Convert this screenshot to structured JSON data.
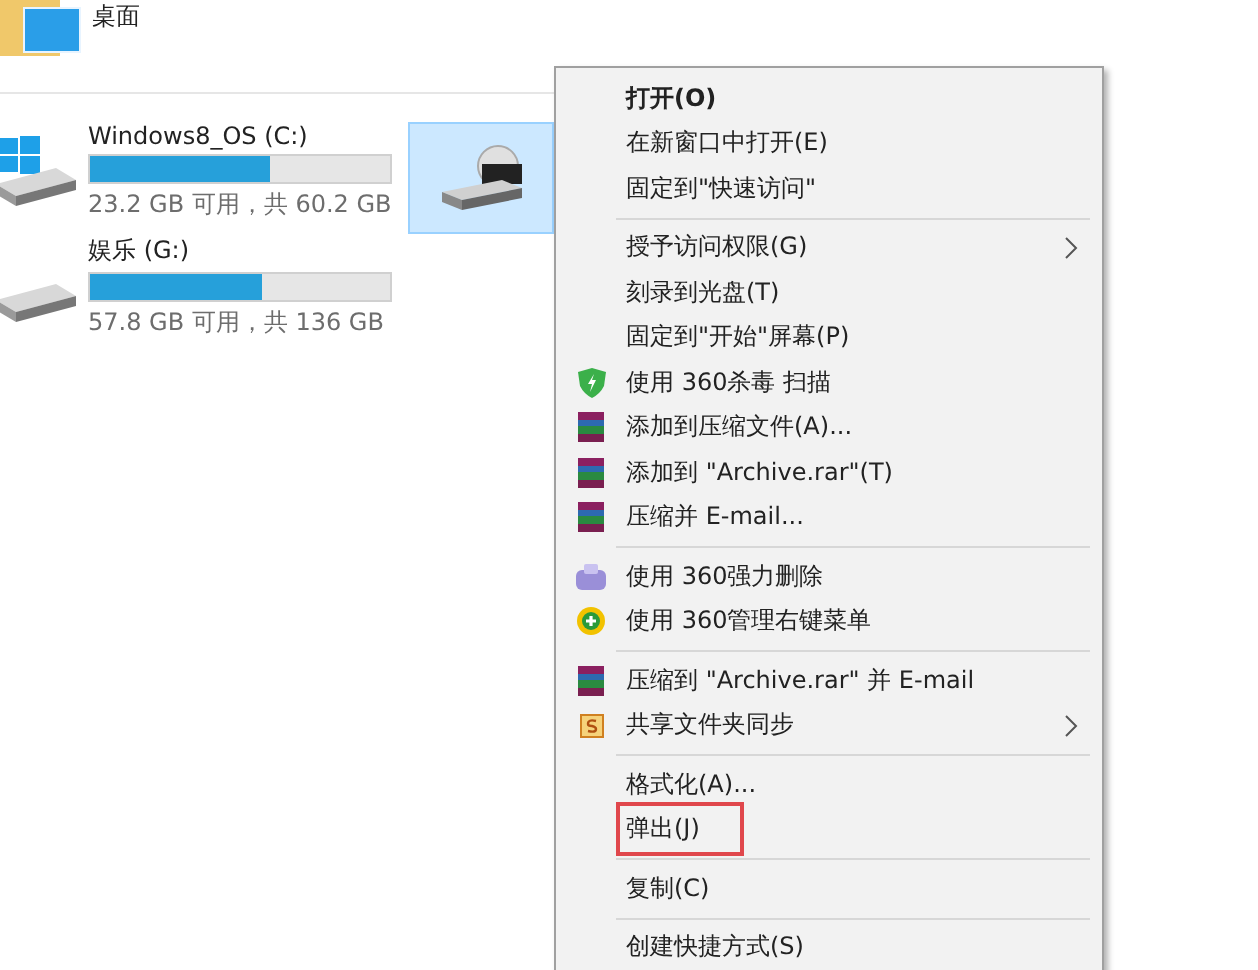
{
  "folder": {
    "label": "桌面"
  },
  "drives": [
    {
      "kind": "windows",
      "name": "Windows8_OS (C:)",
      "level": 0.6,
      "space": "23.2 GB 可用，共 60.2 GB"
    },
    {
      "kind": "disk",
      "name": "娱乐 (G:)",
      "level": 0.57,
      "space": "57.8 GB 可用，共 136 GB"
    }
  ],
  "dvd_tile": {
    "selected": true
  },
  "context_menu": {
    "groups": [
      [
        {
          "label": "打开(O)",
          "kind": "plain",
          "default": true,
          "submenu": false,
          "marked": false
        },
        {
          "label": "在新窗口中打开(E)",
          "kind": "plain",
          "default": false,
          "submenu": false,
          "marked": false
        },
        {
          "label": "固定到\"快速访问\"",
          "kind": "plain",
          "default": false,
          "submenu": false,
          "marked": false
        }
      ],
      [
        {
          "label": "授予访问权限(G)",
          "kind": "plain",
          "default": false,
          "submenu": true,
          "marked": false
        },
        {
          "label": "刻录到光盘(T)",
          "kind": "plain",
          "default": false,
          "submenu": false,
          "marked": false
        },
        {
          "label": "固定到\"开始\"屏幕(P)",
          "kind": "plain",
          "default": false,
          "submenu": false,
          "marked": false
        },
        {
          "label": "使用 360杀毒 扫描",
          "kind": "shield",
          "default": false,
          "submenu": false,
          "marked": false
        },
        {
          "label": "添加到压缩文件(A)...",
          "kind": "archive",
          "default": false,
          "submenu": false,
          "marked": false
        },
        {
          "label": "添加到 \"Archive.rar\"(T)",
          "kind": "archive",
          "default": false,
          "submenu": false,
          "marked": false
        },
        {
          "label": "压缩并 E-mail...",
          "kind": "archive",
          "default": false,
          "submenu": false,
          "marked": false
        }
      ],
      [
        {
          "label": "使用 360强力删除",
          "kind": "eraser",
          "default": false,
          "submenu": false,
          "marked": false
        },
        {
          "label": "使用 360管理右键菜单",
          "kind": "plus",
          "default": false,
          "submenu": false,
          "marked": false
        }
      ],
      [
        {
          "label": "压缩到 \"Archive.rar\" 并 E-mail",
          "kind": "archive",
          "default": false,
          "submenu": false,
          "marked": false
        },
        {
          "label": "共享文件夹同步",
          "kind": "sync",
          "default": false,
          "submenu": true,
          "marked": false
        }
      ],
      [
        {
          "label": "格式化(A)...",
          "kind": "plain",
          "default": false,
          "submenu": false,
          "marked": false
        },
        {
          "label": "弹出(J)",
          "kind": "plain",
          "default": false,
          "submenu": false,
          "marked": true
        }
      ],
      [
        {
          "label": "复制(C)",
          "kind": "plain",
          "default": false,
          "submenu": false,
          "marked": false
        }
      ],
      [
        {
          "label": "创建快捷方式(S)",
          "kind": "plain",
          "default": false,
          "submenu": false,
          "marked": false
        }
      ]
    ]
  }
}
